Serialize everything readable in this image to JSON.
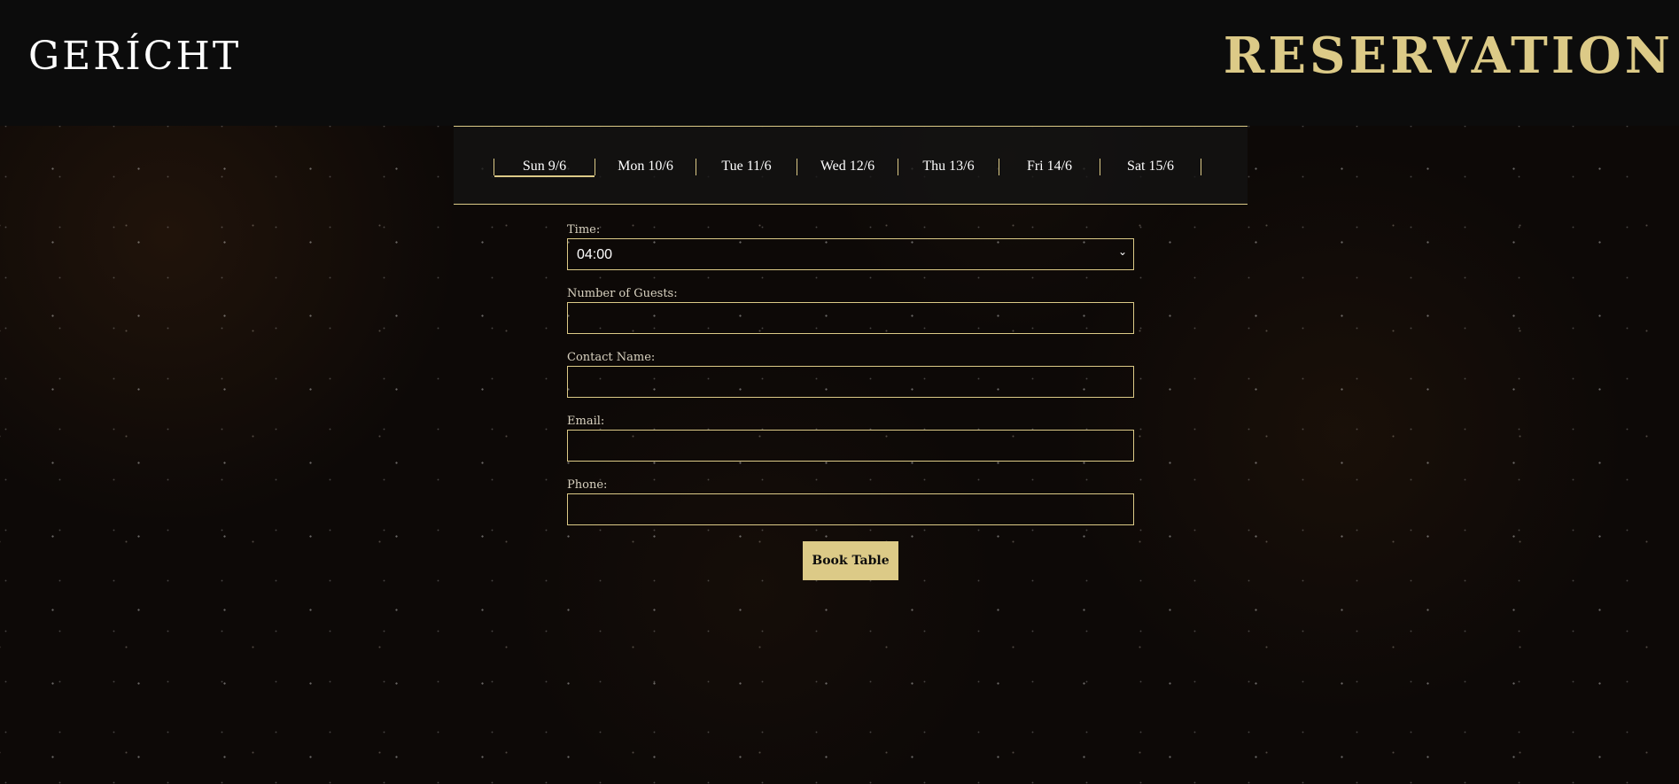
{
  "header": {
    "logo": "GERÍCHT",
    "title": "RESERVATION"
  },
  "dates": [
    {
      "label": "Sun 9/6",
      "active": true
    },
    {
      "label": "Mon 10/6",
      "active": false
    },
    {
      "label": "Tue 11/6",
      "active": false
    },
    {
      "label": "Wed 12/6",
      "active": false
    },
    {
      "label": "Thu 13/6",
      "active": false
    },
    {
      "label": "Fri 14/6",
      "active": false
    },
    {
      "label": "Sat 15/6",
      "active": false
    }
  ],
  "form": {
    "time_label": "Time:",
    "time_value": "04:00",
    "guests_label": "Number of Guests:",
    "guests_value": "",
    "name_label": "Contact Name:",
    "name_value": "",
    "email_label": "Email:",
    "email_value": "",
    "phone_label": "Phone:",
    "phone_value": "",
    "submit_label": "Book Table"
  },
  "colors": {
    "accent": "#dcca87",
    "header_bg": "#0c0c0c",
    "text": "#ffffff"
  }
}
